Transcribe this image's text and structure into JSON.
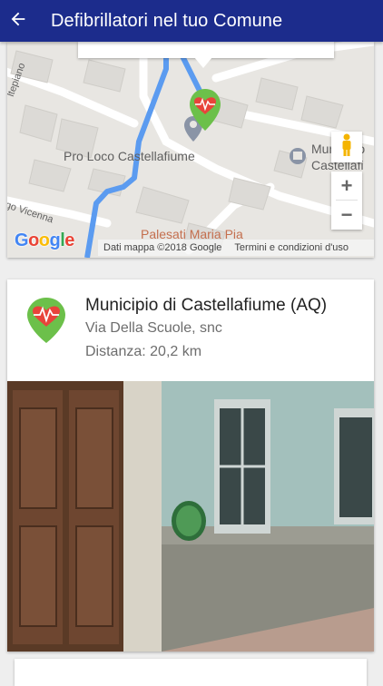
{
  "appbar": {
    "title": "Defibrillatori nel tuo Comune",
    "back_icon": "arrow-back-icon"
  },
  "map": {
    "labels": {
      "pro_loco": "Pro Loco Castellafiume",
      "municipio_1": "Municipio",
      "municipio_2": "Castellafi",
      "palesati": "Palesati Maria Pia",
      "via_vicenna": "go Vicenna",
      "altopiano": "ltepiano"
    },
    "google_logo": "Google",
    "data_text": "Dati mappa ©2018 Google",
    "terms_text": "Termini e condizioni d'uso",
    "zoom_in": "+",
    "zoom_out": "−",
    "route_color": "#5b9bf0",
    "marker_color": "#6cc04a"
  },
  "card": {
    "title": "Municipio di Castellafiume (AQ)",
    "address": "Via Della Scuole, snc",
    "distance": "Distanza: 20,2 km",
    "icon": "defibrillator-heart-icon"
  }
}
